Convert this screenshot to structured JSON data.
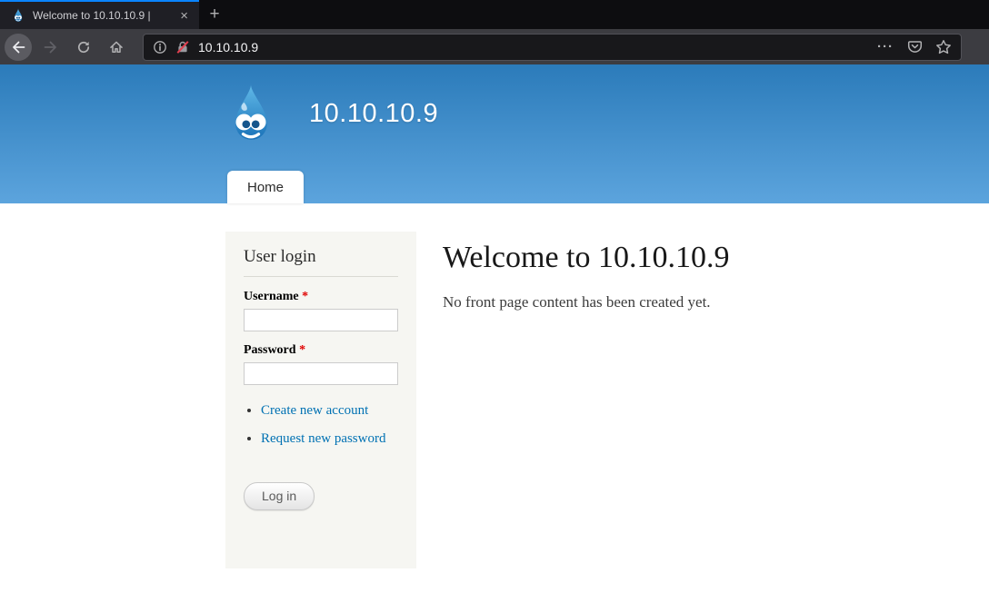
{
  "browser": {
    "tab": {
      "title": "Welcome to 10.10.10.9 |",
      "close_glyph": "×"
    },
    "new_tab_glyph": "+",
    "url": "10.10.10.9",
    "page_actions_glyph": "···"
  },
  "site": {
    "name": "10.10.10.9",
    "menu": [
      {
        "label": "Home"
      }
    ]
  },
  "login_block": {
    "title": "User login",
    "fields": [
      {
        "label": "Username",
        "required_marker": "*"
      },
      {
        "label": "Password",
        "required_marker": "*"
      }
    ],
    "links": [
      {
        "label": "Create new account"
      },
      {
        "label": "Request new password"
      }
    ],
    "submit_label": "Log in"
  },
  "main": {
    "heading": "Welcome to 10.10.10.9",
    "empty_message": "No front page content has been created yet."
  },
  "colors": {
    "accent_tab_line": "#0a84ff",
    "header_gradient_top": "#2b7bba",
    "header_gradient_bottom": "#5ca4dd",
    "link": "#0071b3",
    "required_marker": "#e00000",
    "sidebar_background": "#f6f6f2",
    "insecure_slash": "#e03e4e"
  }
}
